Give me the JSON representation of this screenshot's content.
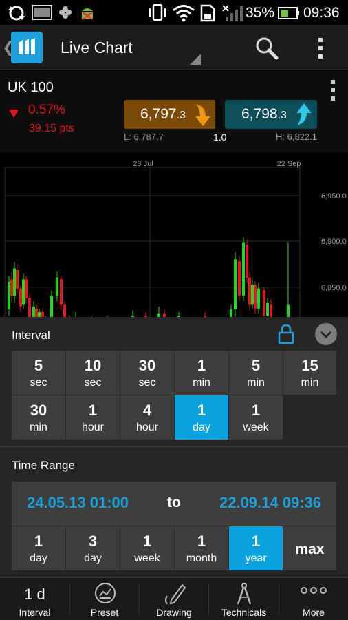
{
  "status_bar": {
    "battery": "35%",
    "time": "09:36",
    "icons": [
      "sync-icon",
      "gallery-icon",
      "pinwheel-icon",
      "android-debug-icon",
      "vibrate-icon",
      "wifi-icon",
      "sim-icon",
      "signal-icon",
      "battery-icon"
    ]
  },
  "action_bar": {
    "title": "Live Chart",
    "icons": [
      "back-icon",
      "app-logo-icon",
      "search-icon",
      "overflow-menu-icon"
    ]
  },
  "quote": {
    "instrument": "UK 100",
    "change_pct": "0.57%",
    "change_pts": "39.15 pts",
    "sell_main": "6,797",
    "sell_frac": ".3",
    "buy_main": "6,798",
    "buy_frac": ".3",
    "low": "L: 6,787.7",
    "spread": "1.0",
    "high": "H: 6,822.1",
    "colors": {
      "down": "#e0141e",
      "sell": "#7a4a06",
      "buy": "#0b4f5a",
      "sell_arrow": "#f0960a",
      "buy_arrow": "#2fc8e8"
    }
  },
  "chart": {
    "date_labels": [
      "23 Jul",
      "22 Sep"
    ],
    "price_labels": [
      "6,950.0",
      "6,900.0",
      "6,850.0"
    ],
    "colors": {
      "up": "#1adb1a",
      "down": "#e8141e"
    }
  },
  "chart_data": {
    "type": "candlestick",
    "title": "",
    "xlabel": "",
    "ylabel": "",
    "x_ticks": [
      "23 Jul",
      "22 Sep"
    ],
    "y_ticks": [
      6950.0,
      6900.0,
      6850.0
    ],
    "ylim": [
      6788,
      6990
    ],
    "candles": [
      {
        "open": 6825,
        "close": 6855,
        "high": 6862,
        "low": 6818,
        "dir": "up"
      },
      {
        "open": 6858,
        "close": 6840,
        "high": 6866,
        "low": 6832,
        "dir": "down"
      },
      {
        "open": 6840,
        "close": 6870,
        "high": 6877,
        "low": 6832,
        "dir": "up"
      },
      {
        "open": 6868,
        "close": 6848,
        "high": 6875,
        "low": 6842,
        "dir": "down"
      },
      {
        "open": 6848,
        "close": 6828,
        "high": 6852,
        "low": 6822,
        "dir": "down"
      },
      {
        "open": 6830,
        "close": 6858,
        "high": 6864,
        "low": 6826,
        "dir": "up"
      },
      {
        "open": 6858,
        "close": 6838,
        "high": 6862,
        "low": 6832,
        "dir": "down"
      },
      {
        "open": 6838,
        "close": 6812,
        "high": 6842,
        "low": 6806,
        "dir": "down"
      },
      {
        "open": 6812,
        "close": 6828,
        "high": 6834,
        "low": 6806,
        "dir": "up"
      },
      {
        "open": 6826,
        "close": 6808,
        "high": 6830,
        "low": 6802,
        "dir": "down"
      },
      {
        "open": 6808,
        "close": 6822,
        "high": 6826,
        "low": 6804,
        "dir": "up"
      },
      {
        "open": 6822,
        "close": 6806,
        "high": 6826,
        "low": 6800,
        "dir": "down"
      },
      {
        "open": 6806,
        "close": 6812,
        "high": 6818,
        "low": 6802,
        "dir": "up"
      },
      {
        "open": 6812,
        "close": 6802,
        "high": 6816,
        "low": 6796,
        "dir": "down"
      },
      {
        "open": 6802,
        "close": 6840,
        "high": 6846,
        "low": 6798,
        "dir": "up"
      },
      {
        "open": 6840,
        "close": 6860,
        "high": 6866,
        "low": 6834,
        "dir": "up"
      },
      {
        "open": 6858,
        "close": 6830,
        "high": 6862,
        "low": 6824,
        "dir": "down"
      },
      {
        "open": 6830,
        "close": 6800,
        "high": 6834,
        "low": 6794,
        "dir": "down"
      },
      {
        "open": 6800,
        "close": 6812,
        "high": 6818,
        "low": 6796,
        "dir": "up"
      },
      {
        "open": 6812,
        "close": 6804,
        "high": 6816,
        "low": 6798,
        "dir": "down"
      },
      {
        "open": 6804,
        "close": 6816,
        "high": 6822,
        "low": 6800,
        "dir": "up"
      },
      {
        "open": 6814,
        "close": 6808,
        "high": 6818,
        "low": 6802,
        "dir": "down"
      },
      {
        "open": 6806,
        "close": 6812,
        "high": 6818,
        "low": 6802,
        "dir": "up"
      },
      {
        "open": 6810,
        "close": 6818,
        "high": 6824,
        "low": 6806,
        "dir": "up"
      },
      {
        "open": 6818,
        "close": 6810,
        "high": 6822,
        "low": 6806,
        "dir": "down"
      },
      {
        "open": 6810,
        "close": 6820,
        "high": 6828,
        "low": 6806,
        "dir": "up"
      },
      {
        "open": 6820,
        "close": 6812,
        "high": 6824,
        "low": 6808,
        "dir": "down"
      },
      {
        "open": 6812,
        "close": 6818,
        "high": 6822,
        "low": 6808,
        "dir": "up"
      },
      {
        "open": 6818,
        "close": 6810,
        "high": 6822,
        "low": 6806,
        "dir": "down"
      },
      {
        "open": 6810,
        "close": 6825,
        "high": 6830,
        "low": 6806,
        "dir": "up"
      },
      {
        "open": 6825,
        "close": 6880,
        "high": 6888,
        "low": 6818,
        "dir": "up"
      },
      {
        "open": 6878,
        "close": 6840,
        "high": 6884,
        "low": 6834,
        "dir": "down"
      },
      {
        "open": 6840,
        "close": 6898,
        "high": 6904,
        "low": 6834,
        "dir": "up"
      },
      {
        "open": 6896,
        "close": 6860,
        "high": 6902,
        "low": 6854,
        "dir": "down"
      },
      {
        "open": 6860,
        "close": 6830,
        "high": 6866,
        "low": 6824,
        "dir": "down"
      },
      {
        "open": 6830,
        "close": 6852,
        "high": 6858,
        "low": 6826,
        "dir": "up"
      },
      {
        "open": 6852,
        "close": 6826,
        "high": 6856,
        "low": 6820,
        "dir": "down"
      },
      {
        "open": 6826,
        "close": 6848,
        "high": 6854,
        "low": 6820,
        "dir": "up"
      },
      {
        "open": 6846,
        "close": 6818,
        "high": 6850,
        "low": 6812,
        "dir": "down"
      },
      {
        "open": 6818,
        "close": 6832,
        "high": 6838,
        "low": 6812,
        "dir": "up"
      },
      {
        "open": 6830,
        "close": 6814,
        "high": 6836,
        "low": 6808,
        "dir": "down"
      },
      {
        "open": 6814,
        "close": 6830,
        "high": 6898,
        "low": 6808,
        "dir": "up"
      }
    ]
  },
  "interval_panel": {
    "title": "Interval",
    "icons": [
      "lock-icon",
      "collapse-icon"
    ],
    "options": [
      {
        "n": "5",
        "u": "sec"
      },
      {
        "n": "10",
        "u": "sec"
      },
      {
        "n": "30",
        "u": "sec"
      },
      {
        "n": "1",
        "u": "min"
      },
      {
        "n": "5",
        "u": "min"
      },
      {
        "n": "15",
        "u": "min"
      },
      {
        "n": "30",
        "u": "min"
      },
      {
        "n": "1",
        "u": "hour"
      },
      {
        "n": "4",
        "u": "hour"
      },
      {
        "n": "1",
        "u": "day"
      },
      {
        "n": "1",
        "u": "week"
      }
    ],
    "selected": "1 day",
    "accent": "#0aa3e0"
  },
  "range_panel": {
    "title": "Time Range",
    "from": "24.05.13 01:00",
    "to_label": "to",
    "until": "22.09.14 09:36",
    "options": [
      {
        "n": "1",
        "u": "day"
      },
      {
        "n": "3",
        "u": "day"
      },
      {
        "n": "1",
        "u": "week"
      },
      {
        "n": "1",
        "u": "month"
      },
      {
        "n": "1",
        "u": "year"
      },
      {
        "n": "max",
        "u": ""
      }
    ],
    "selected": "1 year"
  },
  "bottom_nav": {
    "items": [
      {
        "label": "Interval",
        "value": "1 d"
      },
      {
        "label": "Preset"
      },
      {
        "label": "Drawing"
      },
      {
        "label": "Technicals"
      },
      {
        "label": "More"
      }
    ],
    "icons": [
      "preset-chart-icon",
      "pencil-icon",
      "compass-icon",
      "more-dots-icon"
    ]
  }
}
